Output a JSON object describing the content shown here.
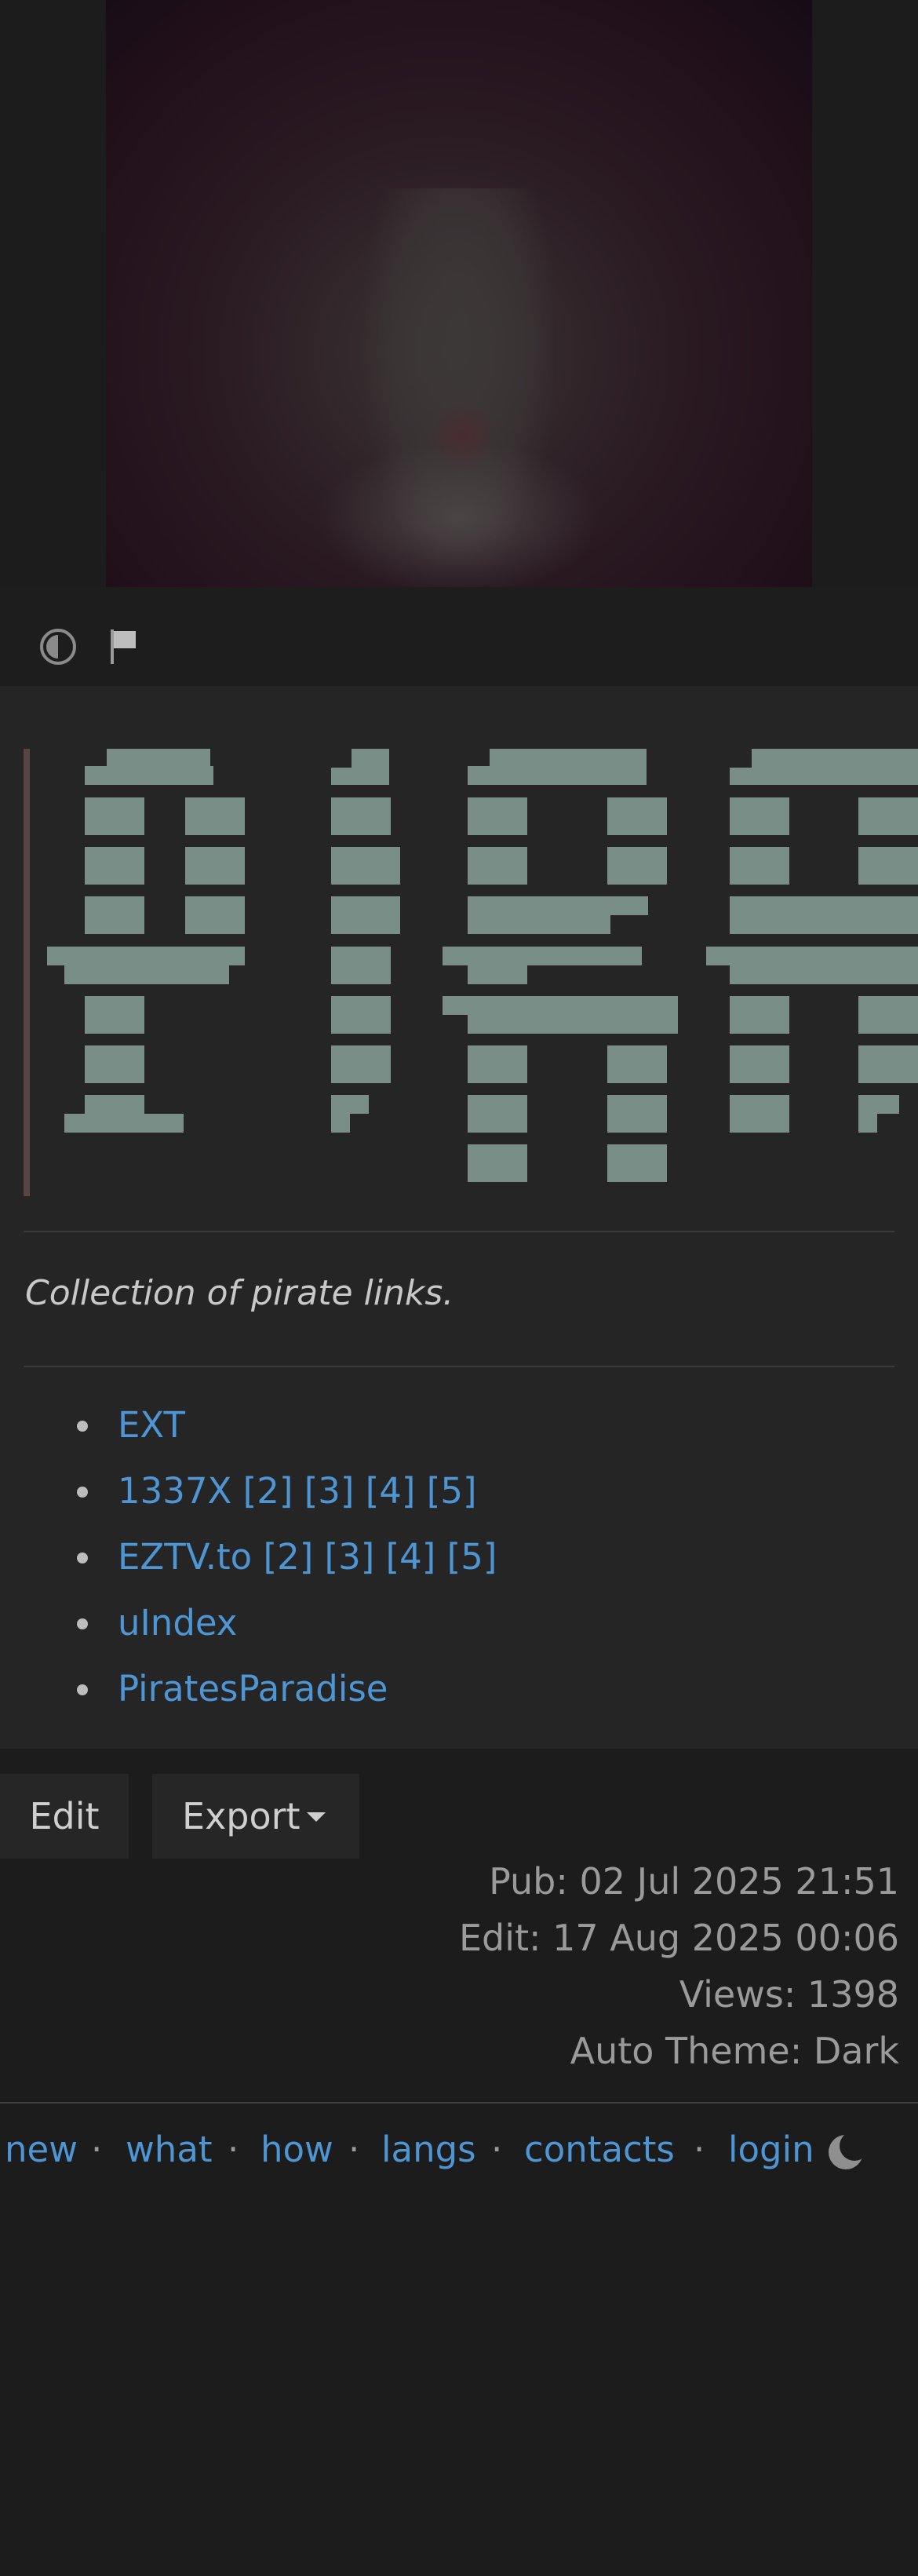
{
  "toolbar": {
    "contrast_icon": "contrast-icon",
    "flag_icon": "flag-icon"
  },
  "post": {
    "banner_text": "PIRA",
    "description": "Collection of pirate links.",
    "links": [
      {
        "label": "EXT"
      },
      {
        "label": "1337X [2] [3] [4] [5]"
      },
      {
        "label": "EZTV.to [2] [3] [4] [5]"
      },
      {
        "label": "uIndex"
      },
      {
        "label": "PiratesParadise"
      }
    ]
  },
  "actions": {
    "edit_label": "Edit",
    "export_label": "Export"
  },
  "meta": {
    "published": "Pub: 02 Jul 2025 21:51",
    "edited": "Edit: 17 Aug 2025 00:06",
    "views": "Views: 1398",
    "theme": "Auto Theme: Dark"
  },
  "footer": {
    "links": [
      "new",
      "what",
      "how",
      "langs",
      "contacts",
      "login"
    ],
    "separator": "·",
    "theme_icon": "moon-icon"
  },
  "colors": {
    "link": "#4e95d4",
    "background": "#1c1c1c",
    "card": "#252525",
    "ascii_art": "#7a8e88"
  }
}
